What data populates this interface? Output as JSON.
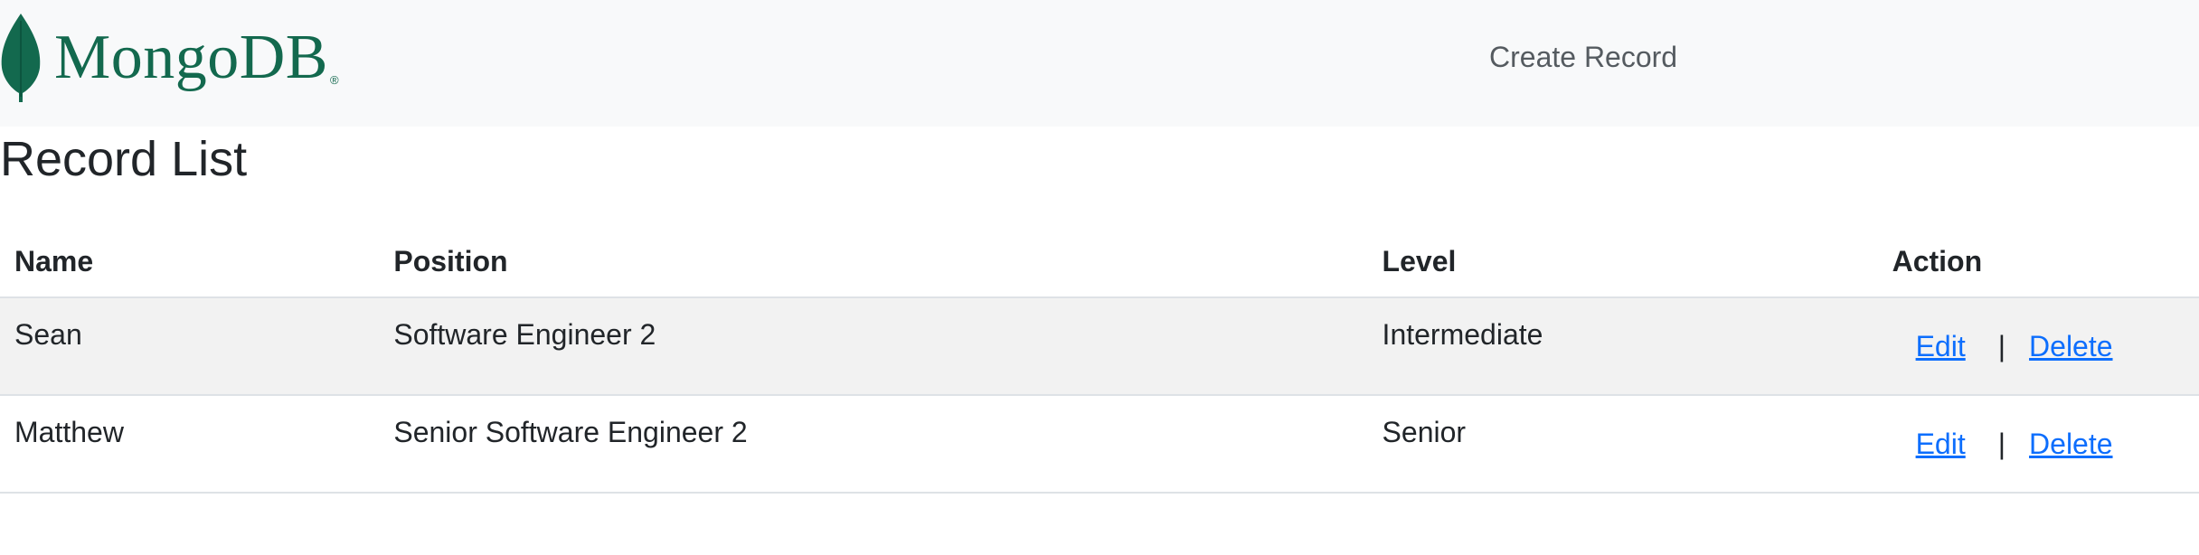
{
  "navbar": {
    "brand_text": "MongoDB",
    "brand_reg": "®",
    "brand_color": "#13694e",
    "create_link": "Create Record"
  },
  "page": {
    "title": "Record List"
  },
  "table": {
    "headers": {
      "name": "Name",
      "position": "Position",
      "level": "Level",
      "action": "Action"
    },
    "rows": [
      {
        "name": "Sean",
        "position": "Software Engineer 2",
        "level": "Intermediate",
        "edit_label": "Edit",
        "separator": "|",
        "delete_label": "Delete"
      },
      {
        "name": "Matthew",
        "position": "Senior Software Engineer 2",
        "level": "Senior",
        "edit_label": "Edit",
        "separator": "|",
        "delete_label": "Delete"
      }
    ]
  },
  "colors": {
    "link": "#0d6efd",
    "navbar_bg": "#f8f9fa",
    "stripe": "#f2f2f2"
  }
}
